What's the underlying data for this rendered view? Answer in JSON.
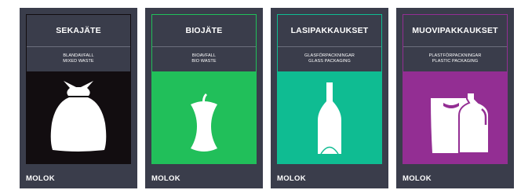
{
  "cards": [
    {
      "title": "SEKAJÄTE",
      "sub1": "BLANDAVFALL",
      "sub2": "MIXED WASTE",
      "accent": "#120d10",
      "icon": "trash-bag-icon",
      "logo": "MOLOK"
    },
    {
      "title": "BIOJÄTE",
      "sub1": "BIOAVFALL",
      "sub2": "BIO WASTE",
      "accent": "#21bf5a",
      "icon": "apple-core-icon",
      "logo": "MOLOK"
    },
    {
      "title": "LASIPAKKAUKSET",
      "sub1": "GLASFÖRPACKNINGAR",
      "sub2": "GLASS PACKAGING",
      "accent": "#0fbc92",
      "icon": "glass-bottle-icon",
      "logo": "MOLOK"
    },
    {
      "title": "MUOVIPAKKAUKSET",
      "sub1": "PLASTFÖRPACKNINGAR",
      "sub2": "PLASTIC PACKAGING",
      "accent": "#932e93",
      "icon": "plastic-packaging-icon",
      "logo": "MOLOK"
    }
  ]
}
